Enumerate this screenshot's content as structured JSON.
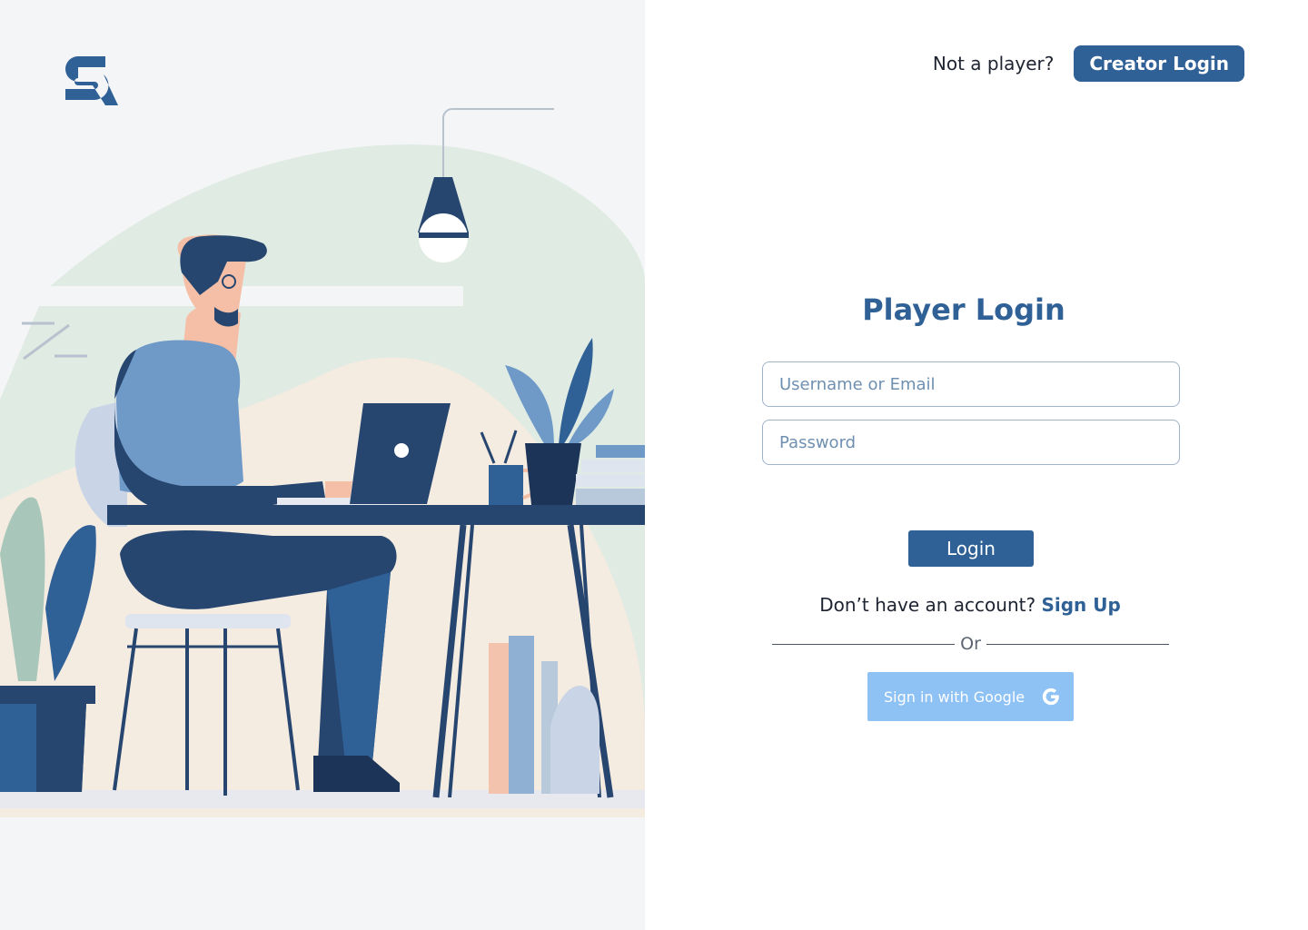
{
  "header": {
    "prompt_text": "Not a player?",
    "creator_login_label": "Creator Login"
  },
  "logo": {
    "icon": "sr-logo-icon",
    "color": "#2f6096"
  },
  "login_form": {
    "title": "Player Login",
    "username_placeholder": "Username or Email",
    "username_value": "",
    "password_placeholder": "Password",
    "password_value": "",
    "submit_label": "Login"
  },
  "signup": {
    "prompt_text": "Don’t have an account?",
    "link_label": "Sign Up"
  },
  "divider": {
    "label": "Or"
  },
  "google_signin": {
    "label": "Sign in with Google",
    "icon": "google-g-icon"
  },
  "colors": {
    "primary": "#2f6096",
    "google_button_bg": "#8ec2f5",
    "left_panel_bg": "#f4f5f7"
  }
}
